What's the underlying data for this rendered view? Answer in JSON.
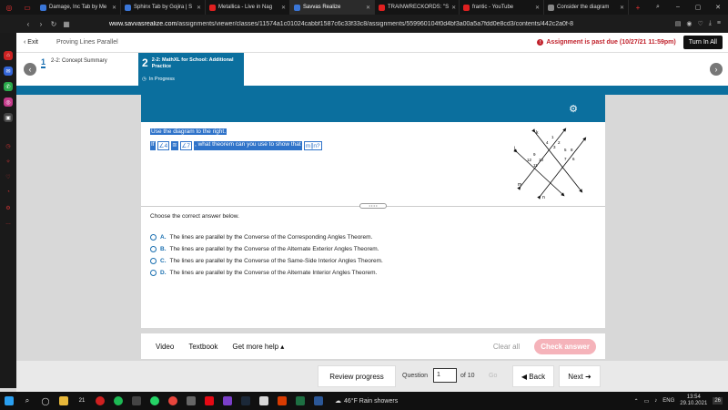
{
  "browser": {
    "tabs": [
      {
        "title": "Damage, Inc Tab by Me",
        "color": "#3a76d8"
      },
      {
        "title": "Sphinx Tab by Gojira | S",
        "color": "#3a76d8"
      },
      {
        "title": "Metallica - Live in Nag",
        "color": "#e02020"
      },
      {
        "title": "Savvas Realize",
        "color": "#3a76d8",
        "active": true
      },
      {
        "title": "TRAINWRECKORDS: \"S",
        "color": "#e02020"
      },
      {
        "title": "frantic - YouTube",
        "color": "#e02020"
      },
      {
        "title": "Consider the diagram",
        "color": "#222222"
      }
    ],
    "url_domain": "www.savvasrealize.com",
    "url_path": "/assignments/viewer/classes/11574a1c01024cabbf1587c6c33f33c8/assignments/559960104f0d4bf3a00a5a7fdd0e8cd3/contents/442c2a0f-8"
  },
  "header": {
    "exit_label": "Exit",
    "lesson_title": "Proving Lines Parallel",
    "past_due": "Assignment is past due (10/27/21 11:59pm)",
    "turn_in": "Turn In All"
  },
  "steps": {
    "step1_num": "1",
    "step1_label": "2-2: Concept Summary",
    "step2_num": "2",
    "step2_label": "2-2: MathXL for School: Additional Practice",
    "step2_status": "In Progress"
  },
  "question": {
    "line1": "Use the diagram to the right.",
    "if_word": "If",
    "angle_a": "∠4",
    "cong": "≅",
    "angle_b": "∠7",
    "rest": ", what theorem can you use to show that",
    "parallel": "m∥n?",
    "prompt": "Choose the correct answer below.",
    "choices": [
      {
        "letter": "A.",
        "text": "The lines are parallel by the Converse of the Corresponding Angles Theorem."
      },
      {
        "letter": "B.",
        "text": "The lines are parallel by the Converse of the Alternate Exterior Angles Theorem."
      },
      {
        "letter": "C.",
        "text": "The lines are parallel by the Converse of the Same-Side Interior Angles Theorem."
      },
      {
        "letter": "D.",
        "text": "The lines are parallel by the Converse of the Alternate Interior Angles Theorem."
      }
    ]
  },
  "diagram": {
    "labels": {
      "k": "k",
      "j": "j",
      "m": "m",
      "n": "n"
    },
    "angles": [
      "1",
      "2",
      "3",
      "4",
      "5",
      "6",
      "7",
      "8",
      "9",
      "10",
      "11",
      "12"
    ]
  },
  "tools": {
    "video": "Video",
    "textbook": "Textbook",
    "more_help": "Get more help ▴",
    "clear_all": "Clear all",
    "check_answer": "Check answer"
  },
  "nav": {
    "review_progress": "Review progress",
    "question_label": "Question",
    "question_value": "1",
    "of_total": "of 10",
    "go": "Go",
    "back": "Back",
    "next": "Next"
  },
  "taskbar": {
    "badge": "21",
    "weather": "46°F  Rain showers",
    "lang": "ENG",
    "time": "13:54",
    "date": "29.10.2021",
    "notif": "26"
  },
  "colors": {
    "teal": "#0b6f9e",
    "past_due_red": "#c0202a",
    "check_pink": "#f5b3ba"
  }
}
